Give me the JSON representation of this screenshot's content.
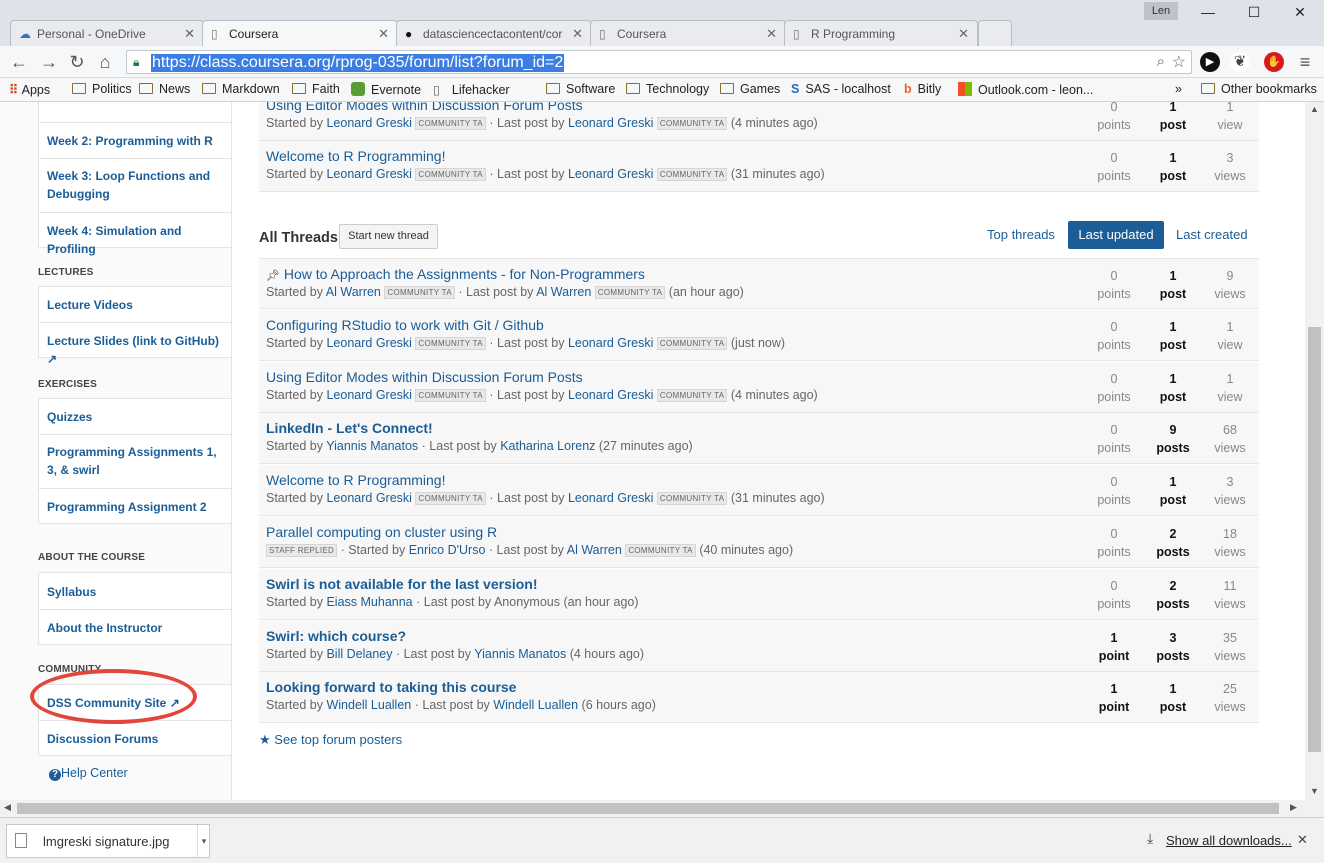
{
  "tabs": [
    {
      "label": "Personal - OneDrive",
      "icon": "cloud-icon"
    },
    {
      "label": "Coursera",
      "icon": "page-icon"
    },
    {
      "label": "datasciencectacontent/cor",
      "icon": "github-icon"
    },
    {
      "label": "Coursera",
      "icon": "page-icon"
    },
    {
      "label": "R Programming",
      "icon": "page-icon"
    }
  ],
  "user_badge": "Len",
  "url": "https://class.coursera.org/rprog-035/forum/list?forum_id=2",
  "bookmarks": [
    "Apps",
    "Politics",
    "News",
    "Markdown",
    "Faith",
    "Evernote",
    "Lifehacker",
    "Software",
    "Technology",
    "Games",
    "SAS - localhost",
    "Bitly",
    "Outlook.com - leon...",
    "»",
    "Other bookmarks"
  ],
  "sidebar": {
    "top_items": [
      "Week 2: Programming with R",
      "Week 3: Loop Functions and Debugging",
      "Week 4: Simulation and Profiling"
    ],
    "lectures_head": "LECTURES",
    "lectures": [
      "Lecture Videos",
      "Lecture Slides (link to GitHub)"
    ],
    "exercises_head": "EXERCISES",
    "exercises": [
      "Quizzes",
      "Programming Assignments 1, 3, & swirl",
      "Programming Assignment 2"
    ],
    "about_head": "ABOUT THE COURSE",
    "about": [
      "Syllabus",
      "About the Instructor"
    ],
    "community_head": "COMMUNITY",
    "community": [
      "DSS Community Site",
      "Discussion Forums"
    ],
    "help": "Help Center"
  },
  "pinned_threads": [
    {
      "title": "Using Editor Modes within Discussion Forum Posts",
      "starter": "Leonard Greski",
      "starter_badge": "COMMUNITY TA",
      "last": "Leonard Greski",
      "last_badge": "COMMUNITY TA",
      "ago": "(4 minutes ago)",
      "points": "0",
      "points_label": "points",
      "posts": "1",
      "posts_label": "post",
      "views": "1",
      "views_label": "view"
    },
    {
      "title": "Welcome to R Programming!",
      "starter": "Leonard Greski",
      "starter_badge": "COMMUNITY TA",
      "last": "Leonard Greski",
      "last_badge": "COMMUNITY TA",
      "ago": "(31 minutes ago)",
      "points": "0",
      "points_label": "points",
      "posts": "1",
      "posts_label": "post",
      "views": "3",
      "views_label": "views"
    }
  ],
  "all_threads": {
    "heading": "All Threads",
    "start_button": "Start new thread",
    "sort_top": "Top threads",
    "sort_updated": "Last updated",
    "sort_created": "Last created",
    "started_by": "Started by",
    "last_post_by": "· Last post by",
    "rows": [
      {
        "title": "How to Approach the Assignments - for Non-Programmers",
        "pinned": true,
        "bold": false,
        "staff": "",
        "starter": "Al Warren",
        "starter_badge": "COMMUNITY TA",
        "last": "Al Warren",
        "last_badge": "COMMUNITY TA",
        "ago": "(an hour ago)",
        "points": "0",
        "points_label": "points",
        "posts": "1",
        "posts_label": "post",
        "views": "9",
        "views_label": "views"
      },
      {
        "title": "Configuring RStudio to work with Git / Github",
        "pinned": false,
        "bold": false,
        "staff": "",
        "starter": "Leonard Greski",
        "starter_badge": "COMMUNITY TA",
        "last": "Leonard Greski",
        "last_badge": "COMMUNITY TA",
        "ago": "(just now)",
        "points": "0",
        "points_label": "points",
        "posts": "1",
        "posts_label": "post",
        "views": "1",
        "views_label": "view"
      },
      {
        "title": "Using Editor Modes within Discussion Forum Posts",
        "pinned": false,
        "bold": false,
        "staff": "",
        "starter": "Leonard Greski",
        "starter_badge": "COMMUNITY TA",
        "last": "Leonard Greski",
        "last_badge": "COMMUNITY TA",
        "ago": "(4 minutes ago)",
        "points": "0",
        "points_label": "points",
        "posts": "1",
        "posts_label": "post",
        "views": "1",
        "views_label": "view"
      },
      {
        "title": "LinkedIn - Let's Connect!",
        "pinned": false,
        "bold": true,
        "staff": "",
        "starter": "Yiannis Manatos",
        "starter_badge": "",
        "last": "Katharina Lorenz",
        "last_badge": "",
        "ago": "(27 minutes ago)",
        "points": "0",
        "points_label": "points",
        "posts": "9",
        "posts_label": "posts",
        "views": "68",
        "views_label": "views"
      },
      {
        "title": "Welcome to R Programming!",
        "pinned": false,
        "bold": false,
        "staff": "",
        "starter": "Leonard Greski",
        "starter_badge": "COMMUNITY TA",
        "last": "Leonard Greski",
        "last_badge": "COMMUNITY TA",
        "ago": "(31 minutes ago)",
        "points": "0",
        "points_label": "points",
        "posts": "1",
        "posts_label": "post",
        "views": "3",
        "views_label": "views"
      },
      {
        "title": "Parallel computing on cluster using R",
        "pinned": false,
        "bold": false,
        "staff": "STAFF REPLIED",
        "starter": "Enrico D'Urso",
        "starter_badge": "",
        "last": "Al Warren",
        "last_badge": "COMMUNITY TA",
        "ago": "(40 minutes ago)",
        "points": "0",
        "points_label": "points",
        "posts": "2",
        "posts_label": "posts",
        "views": "18",
        "views_label": "views"
      },
      {
        "title": "Swirl is not available for the last version!",
        "pinned": false,
        "bold": true,
        "staff": "",
        "starter": "Eiass Muhanna",
        "starter_badge": "",
        "last": "Anonymous",
        "last_badge": "",
        "ago": "(an hour ago)",
        "points": "0",
        "points_label": "points",
        "posts": "2",
        "posts_label": "posts",
        "views": "11",
        "views_label": "views"
      },
      {
        "title": "Swirl: which course?",
        "pinned": false,
        "bold": true,
        "staff": "",
        "starter": "Bill Delaney",
        "starter_badge": "",
        "last": "Yiannis Manatos",
        "last_badge": "",
        "ago": "(4 hours ago)",
        "points": "1",
        "points_label": "point",
        "posts": "3",
        "posts_label": "posts",
        "views": "35",
        "views_label": "views"
      },
      {
        "title": "Looking forward to taking this course",
        "pinned": false,
        "bold": true,
        "staff": "",
        "starter": "Windell Luallen",
        "starter_badge": "",
        "last": "Windell Luallen",
        "last_badge": "",
        "ago": "(6 hours ago)",
        "points": "1",
        "points_label": "point",
        "posts": "1",
        "posts_label": "post",
        "views": "25",
        "views_label": "views"
      }
    ],
    "see_top": "See top forum posters"
  },
  "downloads": {
    "file": "lmgreski signature.jpg",
    "show_all": "Show all downloads..."
  },
  "colors": {
    "link": "#1a5d97",
    "active_sort": "#1a5d97",
    "annotation": "#e0463b"
  }
}
